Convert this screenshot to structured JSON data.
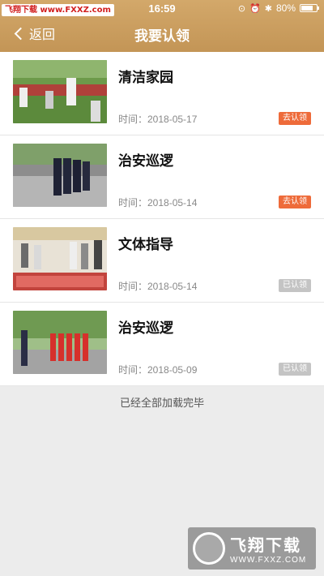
{
  "status_bar": {
    "watermark": "飞翔下载 www.FXXZ.com",
    "time": "16:59",
    "battery": "80%",
    "battery_level": 0.8
  },
  "header": {
    "back_label": "返回",
    "title": "我要认领"
  },
  "items": [
    {
      "title": "清洁家园",
      "date": "时间：2018-05-17",
      "badge": "去认领",
      "claimed": false
    },
    {
      "title": "治安巡逻",
      "date": "时间：2018-05-14",
      "badge": "去认领",
      "claimed": false
    },
    {
      "title": "文体指导",
      "date": "时间：2018-05-14",
      "badge": "已认领",
      "claimed": true
    },
    {
      "title": "治安巡逻",
      "date": "时间：2018-05-09",
      "badge": "已认领",
      "claimed": true
    }
  ],
  "footer": {
    "loaded_message": "已经全部加载完毕"
  },
  "bottom_watermark": {
    "title": "飞翔下载",
    "url": "WWW.FXXZ.COM"
  },
  "colors": {
    "header": "#c8995c",
    "badge_active": "#ee6b3a",
    "badge_done": "#c4c4c4"
  }
}
